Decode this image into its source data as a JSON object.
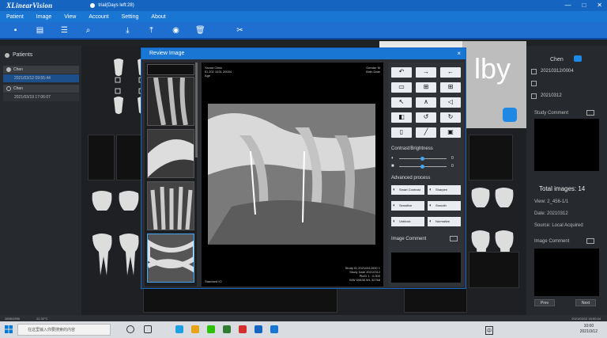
{
  "window": {
    "logo": "XLinearVision",
    "trial": "trial(Days left:28)",
    "controls": [
      "—",
      "□",
      "✕"
    ]
  },
  "menu": [
    "Patient",
    "Image",
    "View",
    "Account",
    "Setting",
    "About"
  ],
  "toolbar_icons": [
    "new-patient-icon",
    "document-icon",
    "list-icon",
    "search-icon",
    "import-icon",
    "export-icon",
    "eye-icon",
    "delete-icon",
    "tools-icon"
  ],
  "patients": {
    "title": "Patients",
    "rows": [
      {
        "name": "Chen",
        "date": "2021/03/12 09:55:44"
      },
      {
        "name": "Chen",
        "date": "2021/03/19 17:06:07"
      }
    ]
  },
  "card": {
    "text": "lby"
  },
  "dialog": {
    "title": "Review Image",
    "close": "×",
    "overlay_tl": [
      "Yanna Clinic",
      "ID 202 1031 20004",
      "Age"
    ],
    "overlay_tr": [
      "Gender M",
      "Birth Date"
    ],
    "overlay_br": [
      "Study ID 20210312000 1",
      "Study Date 20210312",
      "Pix/D 1 : 0.000",
      "WW 60838 WL 32768"
    ],
    "overlay_bl": "Standard IO",
    "contrast_title": "Contrast/Brightness",
    "contrast_values": [
      "0",
      "0"
    ],
    "advanced_title": "Advanced process",
    "process_buttons": [
      "Smart Contrast",
      "Sharpen",
      "Sensitive",
      "Smooth",
      "Unblock",
      "Normalize"
    ],
    "image_comment": "Image Comment"
  },
  "info": {
    "name": "Chen",
    "id": "20210312/0004",
    "date": "20210312",
    "study_comment": "Study Comment",
    "total_images": "Total images:  14",
    "view": "View:  2_456-1/1",
    "date_line": "Date:  20210312",
    "source": "Source:  Local Acquired",
    "image_comment": "Image Comment",
    "buttons": [
      "Prev",
      "Next"
    ]
  },
  "statusbar": {
    "left": "2895/2955",
    "temp": "22.32°C",
    "right": "2021/03/12 16:50:44"
  },
  "taskbar": {
    "search_placeholder": "在这里输入你要搜索的内容",
    "clock_time": "10:00",
    "clock_date": "2021/3/12",
    "lang": "中"
  }
}
